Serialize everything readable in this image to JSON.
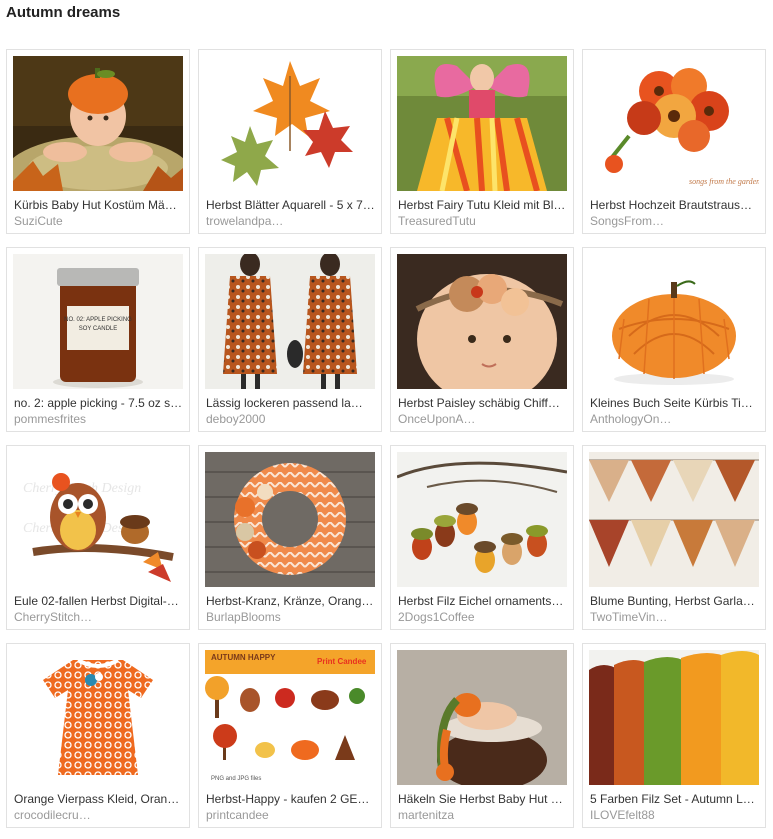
{
  "page": {
    "title": "Autumn dreams"
  },
  "items": [
    {
      "title": "Kürbis Baby Hut Kostüm Mä…",
      "shop": "SuziCute",
      "image": "baby-pumpkin-hat-photo"
    },
    {
      "title": "Herbst Blätter Aquarell - 5 x 7…",
      "shop": "trowelandpa…",
      "image": "autumn-leaves-watercolor"
    },
    {
      "title": "Herbst Fairy Tutu Kleid mit Bl…",
      "shop": "TreasuredTutu",
      "image": "fairy-tutu-dress-photo"
    },
    {
      "title": "Herbst Hochzeit Brautstraus…",
      "shop": "SongsFrom…",
      "image": "wedding-bouquet-photo",
      "watermark": "songs from the garden"
    },
    {
      "title": "no. 2: apple picking - 7.5 oz s…",
      "shop": "pommesfrites",
      "image": "candle-jar-photo",
      "label_lines": [
        "NO. 02: APPLE PICKING",
        "SOY CANDLE"
      ]
    },
    {
      "title": "Lässig lockeren passend la…",
      "shop": "deboy2000",
      "image": "printed-dress-photo"
    },
    {
      "title": "Herbst Paisley schäbig Chiff…",
      "shop": "OnceUponA…",
      "image": "baby-headband-photo"
    },
    {
      "title": "Kleines Buch Seite Kürbis Ti…",
      "shop": "AnthologyOn…",
      "image": "paper-pumpkin-photo"
    },
    {
      "title": "Eule 02-fallen Herbst Digital-…",
      "shop": "CherryStitch…",
      "image": "owl-embroidery-design",
      "watermark": "Cherry Stitch Design"
    },
    {
      "title": "Herbst-Kranz, Kränze, Orang…",
      "shop": "BurlapBlooms",
      "image": "chevron-wreath-photo"
    },
    {
      "title": "Herbst Filz Eichel ornaments…",
      "shop": "2Dogs1Coffee",
      "image": "felt-acorn-ornaments-photo"
    },
    {
      "title": "Blume Bunting, Herbst Garla…",
      "shop": "TwoTimeVin…",
      "image": "bunting-garland-photo"
    },
    {
      "title": "Orange Vierpass Kleid, Oran…",
      "shop": "crocodilecru…",
      "image": "quatrefoil-dress-photo"
    },
    {
      "title": "Herbst-Happy - kaufen 2 GE…",
      "shop": "printcandee",
      "image": "autumn-clipart-set",
      "banner": "AUTUMN HAPPY",
      "brand": "Print Candee",
      "footer_note": "PNG and JPG files"
    },
    {
      "title": "Häkeln Sie Herbst Baby Hut …",
      "shop": "martenitza",
      "image": "newborn-basket-photo"
    },
    {
      "title": "5 Farben Filz Set - Autumn L…",
      "shop": "ILOVEfelt88",
      "image": "felt-sheets-photo"
    }
  ]
}
